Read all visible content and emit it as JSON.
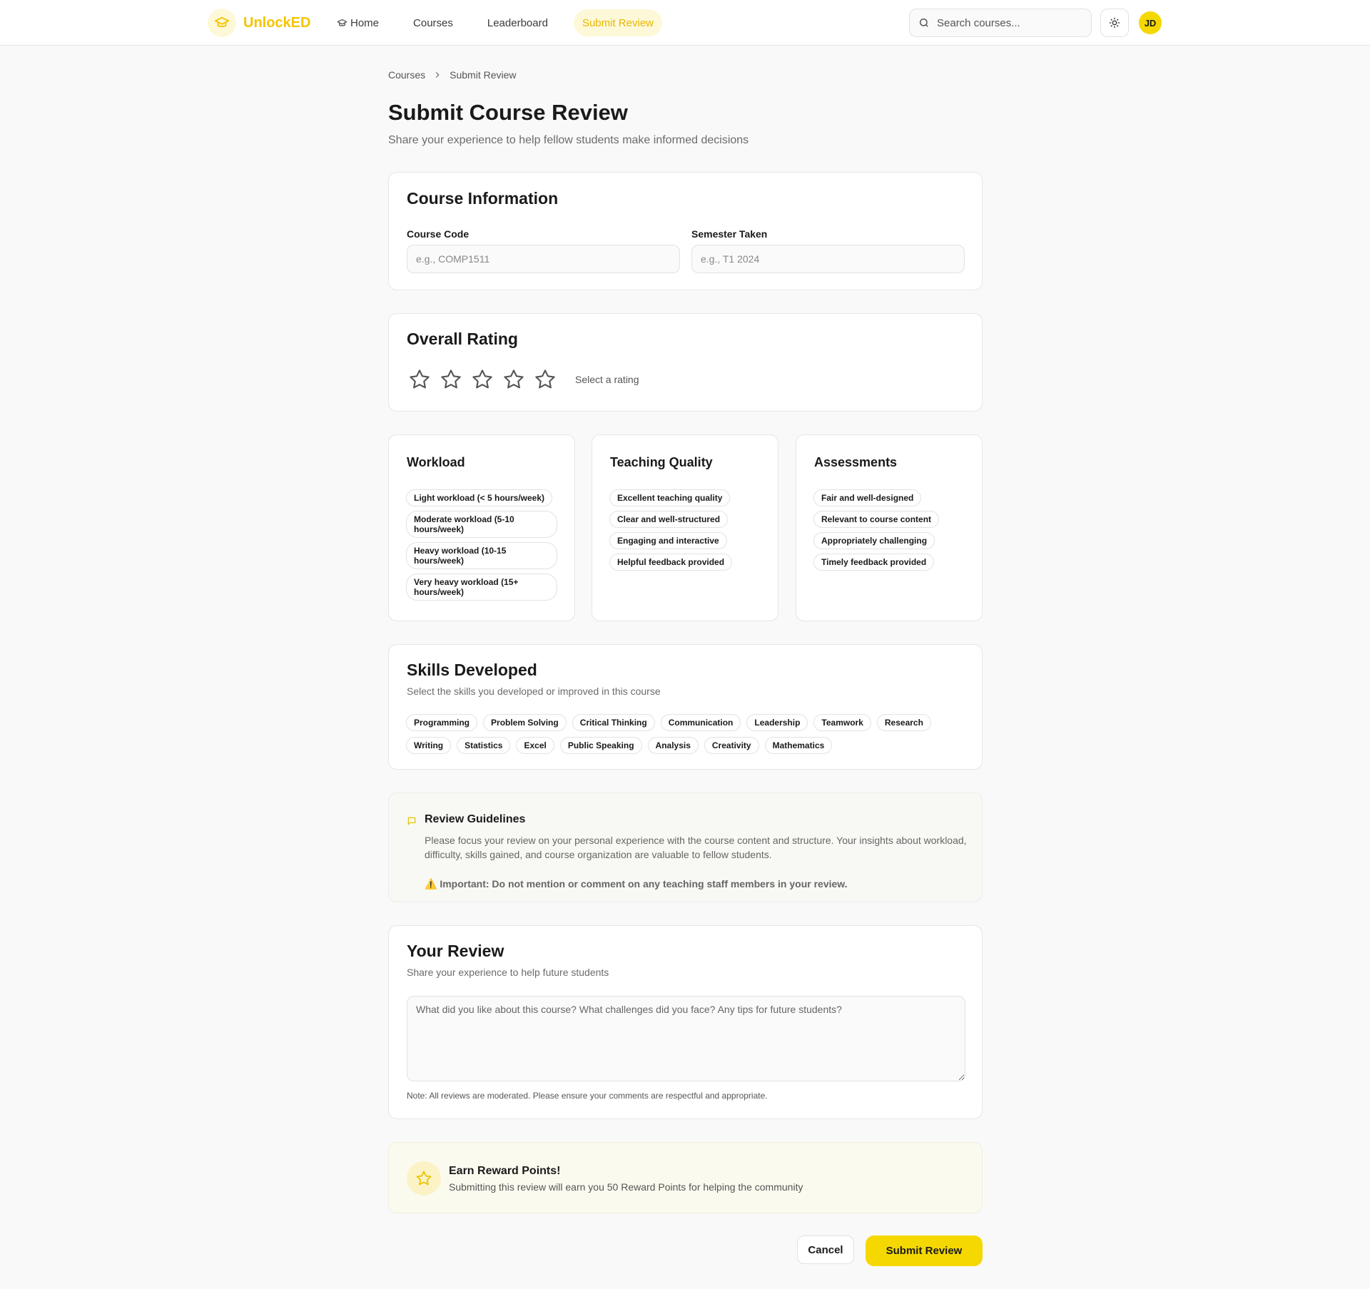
{
  "brand": {
    "name": "UnlockED"
  },
  "nav": {
    "items": [
      {
        "label": "Home",
        "icon": "graduation-cap-icon"
      },
      {
        "label": "Courses"
      },
      {
        "label": "Leaderboard"
      },
      {
        "label": "Submit Review",
        "active": true
      }
    ]
  },
  "search": {
    "placeholder": "Search courses..."
  },
  "user": {
    "initials": "JD"
  },
  "breadcrumb": {
    "parent": "Courses",
    "current": "Submit Review"
  },
  "page": {
    "title": "Submit Course Review",
    "subtitle": "Share your experience to help fellow students make informed decisions"
  },
  "course_info": {
    "title": "Course Information",
    "code_label": "Course Code",
    "code_placeholder": "e.g., COMP1511",
    "semester_label": "Semester Taken",
    "semester_placeholder": "e.g., T1 2024"
  },
  "rating": {
    "title": "Overall Rating",
    "hint": "Select a rating",
    "max": 5,
    "selected": 0
  },
  "workload": {
    "title": "Workload",
    "options": [
      "Light workload (< 5 hours/week)",
      "Moderate workload (5-10 hours/week)",
      "Heavy workload (10-15 hours/week)",
      "Very heavy workload (15+ hours/week)"
    ]
  },
  "teaching": {
    "title": "Teaching Quality",
    "options": [
      "Excellent teaching quality",
      "Clear and well-structured",
      "Engaging and interactive",
      "Helpful feedback provided"
    ]
  },
  "assessments": {
    "title": "Assessments",
    "options": [
      "Fair and well-designed",
      "Relevant to course content",
      "Appropriately challenging",
      "Timely feedback provided"
    ]
  },
  "skills": {
    "title": "Skills Developed",
    "subtitle": "Select the skills you developed or improved in this course",
    "items": [
      "Programming",
      "Problem Solving",
      "Critical Thinking",
      "Communication",
      "Leadership",
      "Teamwork",
      "Research",
      "Writing",
      "Statistics",
      "Excel",
      "Public Speaking",
      "Analysis",
      "Creativity",
      "Mathematics"
    ]
  },
  "guidelines": {
    "title": "Review Guidelines",
    "body": "Please focus your review on your personal experience with the course content and structure. Your insights about workload, difficulty, skills gained, and course organization are valuable to fellow students.",
    "warning": "⚠️ Important: Do not mention or comment on any teaching staff members in your review."
  },
  "review": {
    "title": "Your Review",
    "subtitle": "Share your experience to help future students",
    "placeholder": "What did you like about this course? What challenges did you face? Any tips for future students?",
    "note": "Note: All reviews are moderated. Please ensure your comments are respectful and appropriate."
  },
  "reward": {
    "title": "Earn Reward Points!",
    "subtitle": "Submitting this review will earn you 50 Reward Points for helping the community"
  },
  "actions": {
    "cancel": "Cancel",
    "submit": "Submit Review"
  },
  "colors": {
    "accent": "#f5d800",
    "brand_text": "#f5c400",
    "accent_soft": "#fdf8d8"
  }
}
